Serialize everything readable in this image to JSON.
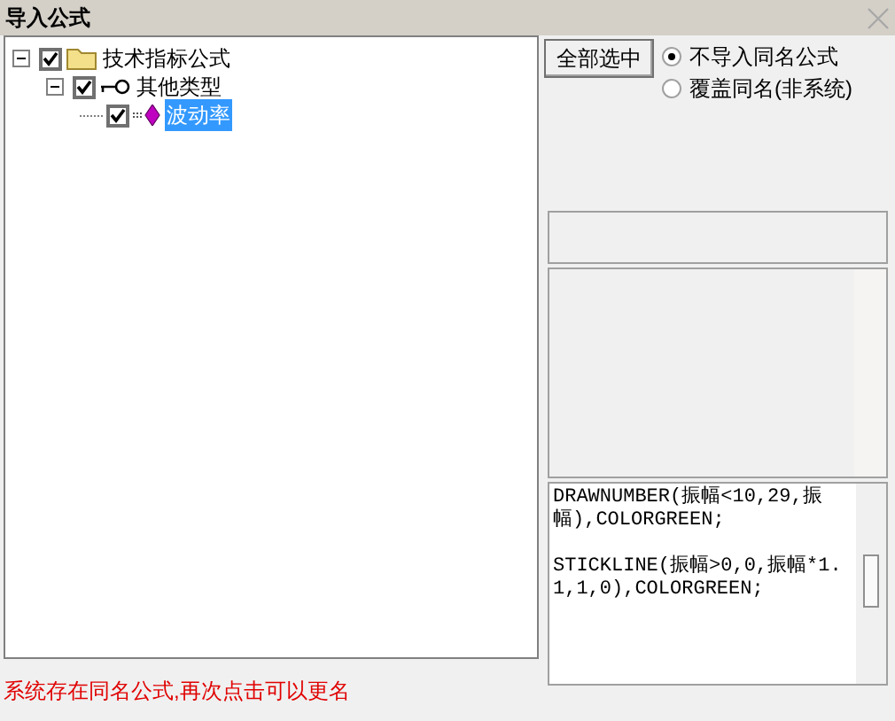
{
  "window": {
    "title": "导入公式"
  },
  "tree": [
    {
      "label": "技术指标公式",
      "kind": "folder",
      "checked": true,
      "expanded": true,
      "selected": false,
      "children": [
        {
          "label": "其他类型",
          "kind": "key",
          "checked": true,
          "expanded": true,
          "selected": false,
          "children": [
            {
              "label": "波动率",
              "kind": "gem",
              "checked": true,
              "selected": true
            }
          ]
        }
      ]
    }
  ],
  "select_all_button": "全部选中",
  "options": [
    {
      "label": "不导入同名公式",
      "selected": true
    },
    {
      "label": "覆盖同名(非系统)",
      "selected": false
    }
  ],
  "formula_text": [
    "DRAWNUMBER(振幅<10,29,振幅),COLORGREEN;",
    "STICKLINE(振幅>0,0,振幅*1.1,1,0),COLORGREEN;"
  ],
  "status": "系统存在同名公式,再次点击可以更名"
}
